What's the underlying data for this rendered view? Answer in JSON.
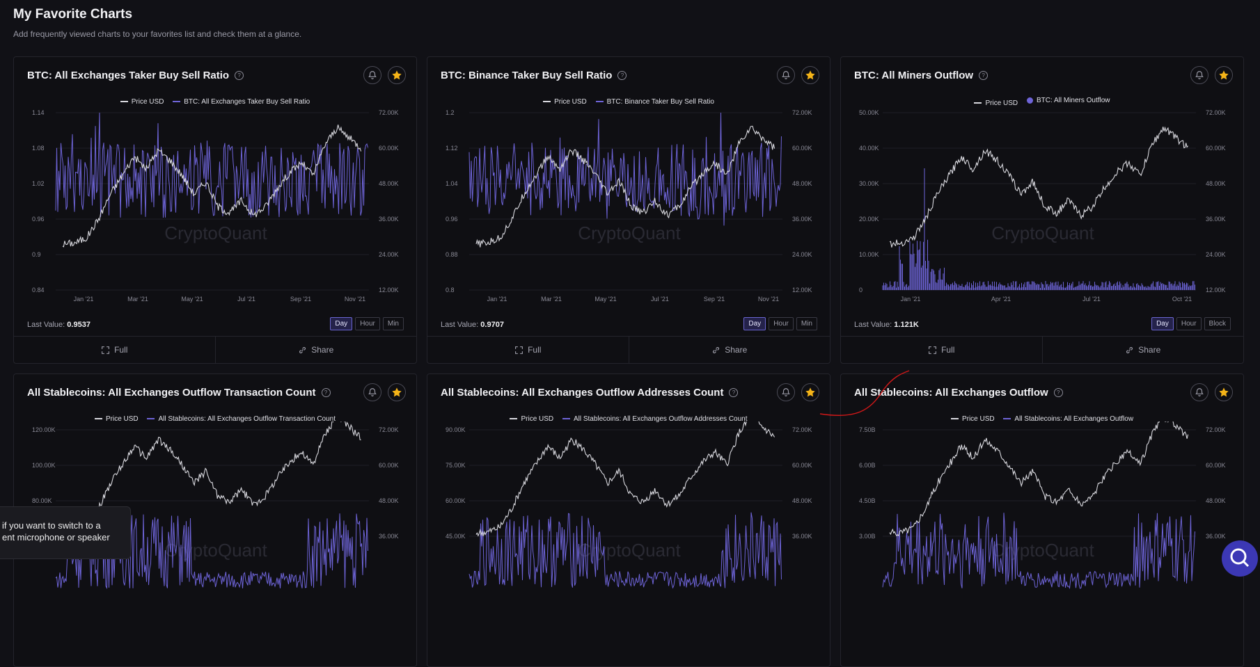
{
  "page": {
    "title": "My Favorite Charts",
    "subtitle": "Add frequently viewed charts to your favorites list and check them at a glance."
  },
  "common": {
    "full_label": "Full",
    "share_label": "Share",
    "last_value_label": "Last Value:",
    "price_legend": "Price USD",
    "watermark": "CryptoQuant",
    "help_glyph": "?"
  },
  "colors": {
    "background": "#111116",
    "card": "#0f0f13",
    "price_line": "#d9d9df",
    "metric": "#6e64d8",
    "star": "#f5b418",
    "accent": "#3c38b5",
    "annotation": "#d01818"
  },
  "icons": {
    "bell": "bell-icon",
    "star": "star-icon",
    "full": "fullscreen-icon",
    "share": "link-icon",
    "help": "help-circle-icon",
    "fab": "search-icon"
  },
  "cards": [
    {
      "title": "BTC: All Exchanges Taker Buy Sell Ratio",
      "legend_metric": "BTC: All Exchanges Taker Buy Sell Ratio",
      "metric_legend_style": "line",
      "left_ticks": [
        "1.14",
        "1.08",
        "1.02",
        "0.96",
        "0.9",
        "0.84"
      ],
      "right_ticks": [
        "72.00K",
        "60.00K",
        "48.00K",
        "36.00K",
        "24.00K",
        "12.00K"
      ],
      "x_ticks": [
        "Jan '21",
        "Mar '21",
        "May '21",
        "Jul '21",
        "Sep '21",
        "Nov '21"
      ],
      "last_value": "0.9537",
      "granularity": [
        "Day",
        "Hour",
        "Min"
      ],
      "active_granularity": "Day"
    },
    {
      "title": "BTC: Binance Taker Buy Sell Ratio",
      "legend_metric": "BTC: Binance Taker Buy Sell Ratio",
      "metric_legend_style": "line",
      "left_ticks": [
        "1.2",
        "1.12",
        "1.04",
        "0.96",
        "0.88",
        "0.8"
      ],
      "right_ticks": [
        "72.00K",
        "60.00K",
        "48.00K",
        "36.00K",
        "24.00K",
        "12.00K"
      ],
      "x_ticks": [
        "Jan '21",
        "Mar '21",
        "May '21",
        "Jul '21",
        "Sep '21",
        "Nov '21"
      ],
      "last_value": "0.9707",
      "granularity": [
        "Day",
        "Hour",
        "Min"
      ],
      "active_granularity": "Day"
    },
    {
      "title": "BTC: All Miners Outflow",
      "legend_metric": "BTC: All Miners Outflow",
      "metric_legend_style": "dot",
      "left_ticks": [
        "50.00K",
        "40.00K",
        "30.00K",
        "20.00K",
        "10.00K",
        "0"
      ],
      "right_ticks": [
        "72.00K",
        "60.00K",
        "48.00K",
        "36.00K",
        "24.00K",
        "12.00K"
      ],
      "x_ticks": [
        "Jan '21",
        "Apr '21",
        "Jul '21",
        "Oct '21"
      ],
      "last_value": "1.121K",
      "granularity": [
        "Day",
        "Hour",
        "Block"
      ],
      "active_granularity": "Day"
    },
    {
      "title": "All Stablecoins: All Exchanges Outflow Transaction Count",
      "legend_metric": "All Stablecoins: All Exchanges Outflow Transaction Count",
      "metric_legend_style": "line",
      "left_ticks": [
        "120.00K",
        "100.00K",
        "80.00K"
      ],
      "right_ticks": [
        "72.00K",
        "60.00K",
        "48.00K",
        "36.00K"
      ]
    },
    {
      "title": "All Stablecoins: All Exchanges Outflow Addresses Count",
      "legend_metric": "All Stablecoins: All Exchanges Outflow Addresses Count",
      "metric_legend_style": "line",
      "left_ticks": [
        "90.00K",
        "75.00K",
        "60.00K",
        "45.00K"
      ],
      "right_ticks": [
        "72.00K",
        "60.00K",
        "48.00K",
        "36.00K"
      ]
    },
    {
      "title": "All Stablecoins: All Exchanges Outflow",
      "legend_metric": "All Stablecoins: All Exchanges Outflow",
      "metric_legend_style": "line",
      "left_ticks": [
        "7.50B",
        "6.00B",
        "4.50B",
        "3.00B"
      ],
      "right_ticks": [
        "72.00K",
        "60.00K",
        "48.00K",
        "36.00K"
      ]
    }
  ],
  "toast": {
    "line1": "if you want to switch to a",
    "line2": "ent microphone or speaker"
  }
}
